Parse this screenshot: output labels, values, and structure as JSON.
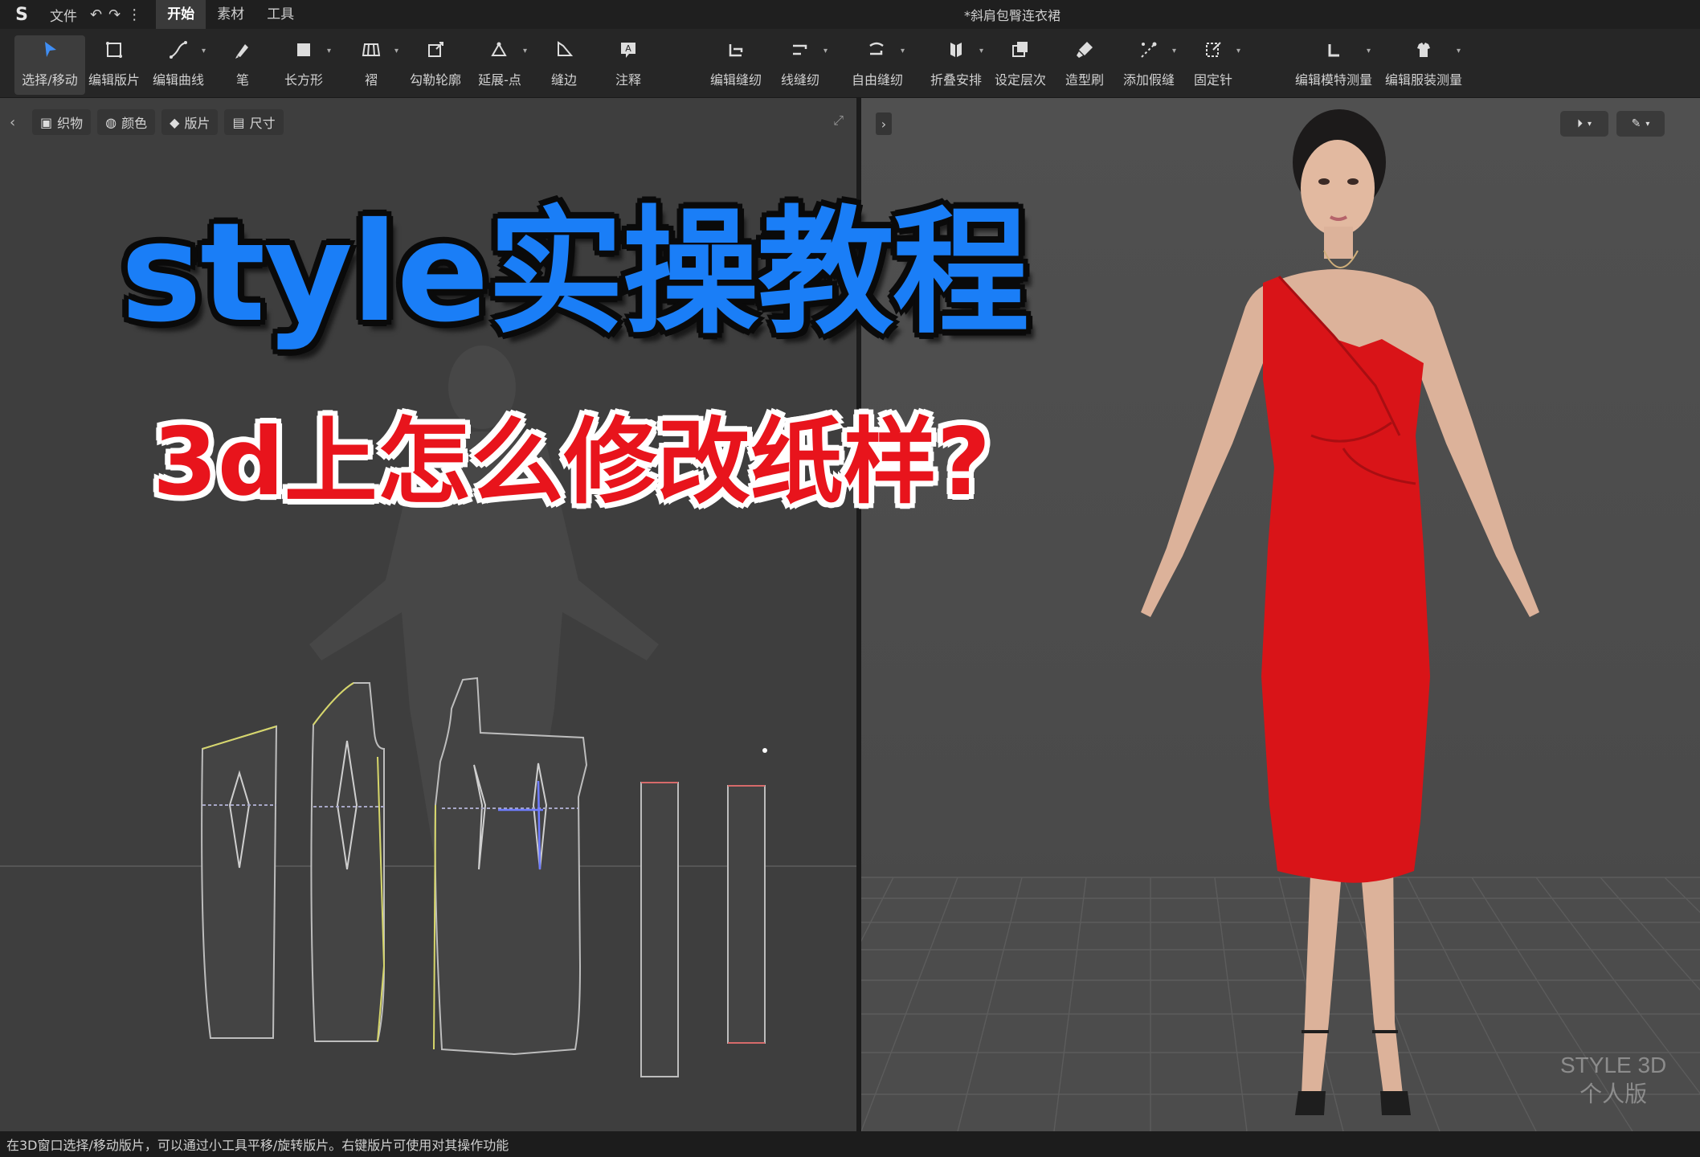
{
  "menubar": {
    "logo": "S",
    "file_label": "文件",
    "tabs": [
      {
        "label": "开始",
        "active": true
      },
      {
        "label": "素材",
        "active": false
      },
      {
        "label": "工具",
        "active": false
      }
    ],
    "document_title": "*斜肩包臀连衣裙"
  },
  "toolbar": {
    "tools": [
      {
        "label": "选择/移动",
        "icon": "select-arrow-icon",
        "active": true
      },
      {
        "label": "编辑版片",
        "icon": "edit-pattern-icon"
      },
      {
        "label": "编辑曲线",
        "icon": "edit-curve-icon"
      },
      {
        "label": "笔",
        "icon": "pen-icon"
      },
      {
        "label": "长方形",
        "icon": "rectangle-icon"
      },
      {
        "label": "褶",
        "icon": "pleat-icon"
      },
      {
        "label": "勾勒轮廓",
        "icon": "trace-outline-icon"
      },
      {
        "label": "延展-点",
        "icon": "extend-point-icon"
      },
      {
        "label": "缝边",
        "icon": "seam-allowance-icon"
      },
      {
        "label": "注释",
        "icon": "annotation-icon"
      },
      {
        "label": "编辑缝纫",
        "icon": "edit-sewing-icon"
      },
      {
        "label": "线缝纫",
        "icon": "line-sewing-icon"
      },
      {
        "label": "自由缝纫",
        "icon": "free-sewing-icon"
      },
      {
        "label": "折叠安排",
        "icon": "fold-arrange-icon"
      },
      {
        "label": "设定层次",
        "icon": "set-layer-icon"
      },
      {
        "label": "造型刷",
        "icon": "shape-brush-icon"
      },
      {
        "label": "添加假缝",
        "icon": "add-tack-icon"
      },
      {
        "label": "固定针",
        "icon": "pin-icon"
      },
      {
        "label": "编辑模特测量",
        "icon": "avatar-measure-icon"
      },
      {
        "label": "编辑服装测量",
        "icon": "garment-measure-icon"
      }
    ]
  },
  "panel2d": {
    "chips": [
      {
        "label": "织物",
        "icon": "fabric-icon"
      },
      {
        "label": "颜色",
        "icon": "color-icon"
      },
      {
        "label": "版片",
        "icon": "pattern-piece-icon"
      },
      {
        "label": "尺寸",
        "icon": "size-icon"
      }
    ]
  },
  "panel3d": {
    "watermark_line1": "STYLE 3D",
    "watermark_line2": "个人版",
    "garment_color": "#d91418"
  },
  "overlay": {
    "title": "style实操教程",
    "subtitle": "3d上怎么修改纸样?"
  },
  "statusbar": {
    "text": "在3D窗口选择/移动版片，可以通过小工具平移/旋转版片。右键版片可使用对其操作功能"
  }
}
